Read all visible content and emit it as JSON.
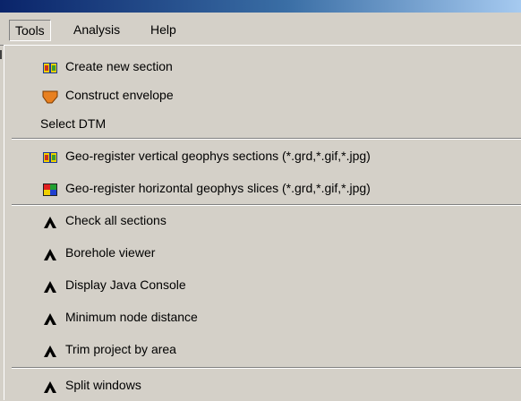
{
  "menubar": {
    "items": [
      {
        "label": "Tools"
      },
      {
        "label": "Analysis"
      },
      {
        "label": "Help"
      }
    ]
  },
  "tools_menu": {
    "items": [
      {
        "label": "Create new section",
        "icon": "section-icon"
      },
      {
        "label": "Construct envelope",
        "icon": "envelope-shape-icon"
      },
      {
        "label": "Select DTM",
        "icon": ""
      },
      {
        "label": "Geo-register vertical geophys sections (*.grd,*.gif,*.jpg)",
        "icon": "vertical-section-icon"
      },
      {
        "label": "Geo-register horizontal geophys slices (*.grd,*.gif,*.jpg)",
        "icon": "horizontal-slice-icon"
      },
      {
        "label": "Check all sections",
        "icon": "tool-icon"
      },
      {
        "label": "Borehole viewer",
        "icon": "tool-icon"
      },
      {
        "label": "Display Java Console",
        "icon": "tool-icon"
      },
      {
        "label": "Minimum node distance",
        "icon": "tool-icon"
      },
      {
        "label": "Trim project by area",
        "icon": "tool-icon"
      },
      {
        "label": "Split windows",
        "icon": "tool-icon"
      }
    ]
  }
}
